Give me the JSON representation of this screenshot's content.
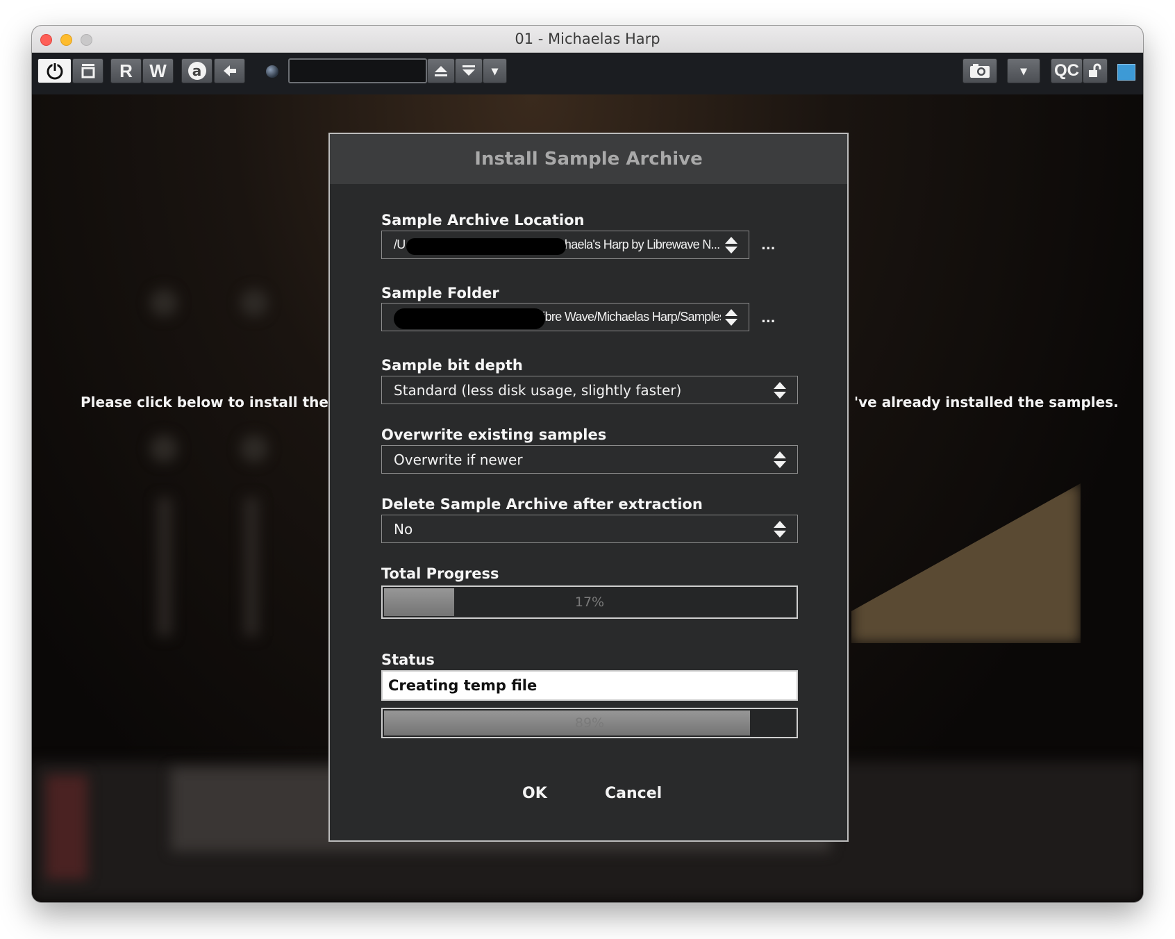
{
  "window": {
    "title": "01 - Michaelas Harp"
  },
  "toolbar": {
    "power_icon": "power-icon",
    "snapshot_icon": "snapshot-icon",
    "read_label": "R",
    "write_label": "W",
    "a_label": "a",
    "back_icon": "arrow-left-icon",
    "preset_value": "",
    "qc_label": "QC",
    "dropdown_icon": "▾"
  },
  "background": {
    "message_left": "Please click below to install the sa",
    "message_right": "'ve already installed the samples."
  },
  "dialog": {
    "title": "Install Sample Archive",
    "archive_location": {
      "label": "Sample Archive Location",
      "value_prefix": "/U",
      "value": "Michaela's Harp by Librewave N...",
      "browse_label": "..."
    },
    "sample_folder": {
      "label": "Sample Folder",
      "value": "Libre Wave/Michaelas Harp/Samples",
      "browse_label": "..."
    },
    "bit_depth": {
      "label": "Sample bit depth",
      "value": "Standard (less disk usage, slightly faster)"
    },
    "overwrite": {
      "label": "Overwrite existing samples",
      "value": "Overwrite if newer"
    },
    "delete_archive": {
      "label": "Delete Sample Archive after extraction",
      "value": "No"
    },
    "total_progress": {
      "label": "Total Progress",
      "percent": 17,
      "percent_label": "17%"
    },
    "status": {
      "label": "Status",
      "value": "Creating temp file",
      "percent": 89,
      "percent_label": "89%"
    },
    "ok_label": "OK",
    "cancel_label": "Cancel"
  },
  "colors": {
    "accent_blue": "#3d9ad6",
    "dialog_bg": "#292a2b",
    "progress_fill": "#8a8a8a"
  }
}
